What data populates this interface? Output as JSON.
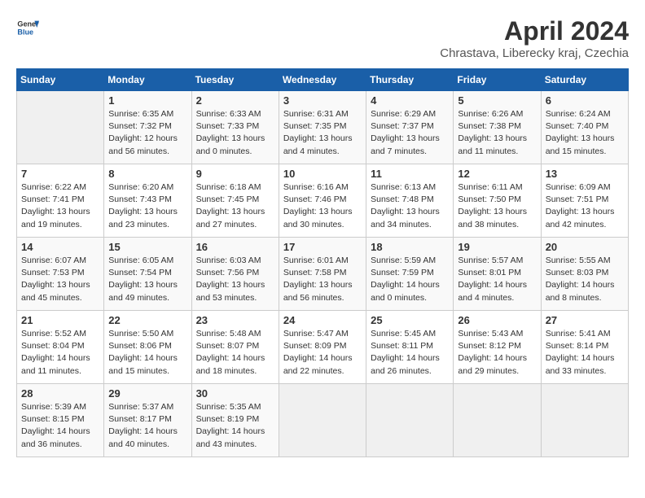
{
  "header": {
    "logo_line1": "General",
    "logo_line2": "Blue",
    "month_title": "April 2024",
    "location": "Chrastava, Liberecky kraj, Czechia"
  },
  "weekdays": [
    "Sunday",
    "Monday",
    "Tuesday",
    "Wednesday",
    "Thursday",
    "Friday",
    "Saturday"
  ],
  "weeks": [
    [
      {
        "day": "",
        "info": ""
      },
      {
        "day": "1",
        "info": "Sunrise: 6:35 AM\nSunset: 7:32 PM\nDaylight: 12 hours\nand 56 minutes."
      },
      {
        "day": "2",
        "info": "Sunrise: 6:33 AM\nSunset: 7:33 PM\nDaylight: 13 hours\nand 0 minutes."
      },
      {
        "day": "3",
        "info": "Sunrise: 6:31 AM\nSunset: 7:35 PM\nDaylight: 13 hours\nand 4 minutes."
      },
      {
        "day": "4",
        "info": "Sunrise: 6:29 AM\nSunset: 7:37 PM\nDaylight: 13 hours\nand 7 minutes."
      },
      {
        "day": "5",
        "info": "Sunrise: 6:26 AM\nSunset: 7:38 PM\nDaylight: 13 hours\nand 11 minutes."
      },
      {
        "day": "6",
        "info": "Sunrise: 6:24 AM\nSunset: 7:40 PM\nDaylight: 13 hours\nand 15 minutes."
      }
    ],
    [
      {
        "day": "7",
        "info": "Sunrise: 6:22 AM\nSunset: 7:41 PM\nDaylight: 13 hours\nand 19 minutes."
      },
      {
        "day": "8",
        "info": "Sunrise: 6:20 AM\nSunset: 7:43 PM\nDaylight: 13 hours\nand 23 minutes."
      },
      {
        "day": "9",
        "info": "Sunrise: 6:18 AM\nSunset: 7:45 PM\nDaylight: 13 hours\nand 27 minutes."
      },
      {
        "day": "10",
        "info": "Sunrise: 6:16 AM\nSunset: 7:46 PM\nDaylight: 13 hours\nand 30 minutes."
      },
      {
        "day": "11",
        "info": "Sunrise: 6:13 AM\nSunset: 7:48 PM\nDaylight: 13 hours\nand 34 minutes."
      },
      {
        "day": "12",
        "info": "Sunrise: 6:11 AM\nSunset: 7:50 PM\nDaylight: 13 hours\nand 38 minutes."
      },
      {
        "day": "13",
        "info": "Sunrise: 6:09 AM\nSunset: 7:51 PM\nDaylight: 13 hours\nand 42 minutes."
      }
    ],
    [
      {
        "day": "14",
        "info": "Sunrise: 6:07 AM\nSunset: 7:53 PM\nDaylight: 13 hours\nand 45 minutes."
      },
      {
        "day": "15",
        "info": "Sunrise: 6:05 AM\nSunset: 7:54 PM\nDaylight: 13 hours\nand 49 minutes."
      },
      {
        "day": "16",
        "info": "Sunrise: 6:03 AM\nSunset: 7:56 PM\nDaylight: 13 hours\nand 53 minutes."
      },
      {
        "day": "17",
        "info": "Sunrise: 6:01 AM\nSunset: 7:58 PM\nDaylight: 13 hours\nand 56 minutes."
      },
      {
        "day": "18",
        "info": "Sunrise: 5:59 AM\nSunset: 7:59 PM\nDaylight: 14 hours\nand 0 minutes."
      },
      {
        "day": "19",
        "info": "Sunrise: 5:57 AM\nSunset: 8:01 PM\nDaylight: 14 hours\nand 4 minutes."
      },
      {
        "day": "20",
        "info": "Sunrise: 5:55 AM\nSunset: 8:03 PM\nDaylight: 14 hours\nand 8 minutes."
      }
    ],
    [
      {
        "day": "21",
        "info": "Sunrise: 5:52 AM\nSunset: 8:04 PM\nDaylight: 14 hours\nand 11 minutes."
      },
      {
        "day": "22",
        "info": "Sunrise: 5:50 AM\nSunset: 8:06 PM\nDaylight: 14 hours\nand 15 minutes."
      },
      {
        "day": "23",
        "info": "Sunrise: 5:48 AM\nSunset: 8:07 PM\nDaylight: 14 hours\nand 18 minutes."
      },
      {
        "day": "24",
        "info": "Sunrise: 5:47 AM\nSunset: 8:09 PM\nDaylight: 14 hours\nand 22 minutes."
      },
      {
        "day": "25",
        "info": "Sunrise: 5:45 AM\nSunset: 8:11 PM\nDaylight: 14 hours\nand 26 minutes."
      },
      {
        "day": "26",
        "info": "Sunrise: 5:43 AM\nSunset: 8:12 PM\nDaylight: 14 hours\nand 29 minutes."
      },
      {
        "day": "27",
        "info": "Sunrise: 5:41 AM\nSunset: 8:14 PM\nDaylight: 14 hours\nand 33 minutes."
      }
    ],
    [
      {
        "day": "28",
        "info": "Sunrise: 5:39 AM\nSunset: 8:15 PM\nDaylight: 14 hours\nand 36 minutes."
      },
      {
        "day": "29",
        "info": "Sunrise: 5:37 AM\nSunset: 8:17 PM\nDaylight: 14 hours\nand 40 minutes."
      },
      {
        "day": "30",
        "info": "Sunrise: 5:35 AM\nSunset: 8:19 PM\nDaylight: 14 hours\nand 43 minutes."
      },
      {
        "day": "",
        "info": ""
      },
      {
        "day": "",
        "info": ""
      },
      {
        "day": "",
        "info": ""
      },
      {
        "day": "",
        "info": ""
      }
    ]
  ]
}
